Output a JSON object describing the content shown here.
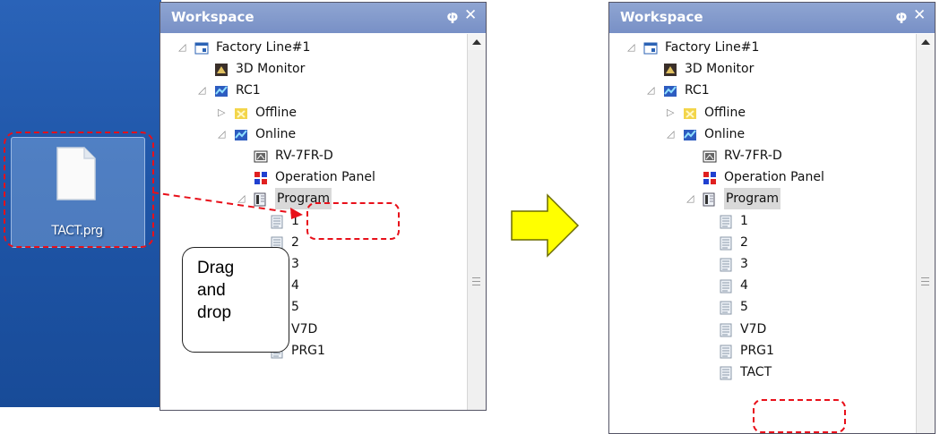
{
  "desktop": {
    "file": {
      "name": "TACT.prg"
    }
  },
  "callout": {
    "lines": [
      "Drag",
      "and",
      "drop"
    ]
  },
  "workspace": {
    "title": "Workspace",
    "pin_glyph": "p",
    "close_glyph": "✕",
    "tree": [
      {
        "label": "Factory Line#1",
        "level": 0,
        "expander": "◿",
        "icon": "project-icon"
      },
      {
        "label": "3D Monitor",
        "level": 1,
        "expander": "",
        "icon": "3d-monitor-icon"
      },
      {
        "label": "RC1",
        "level": 1,
        "expander": "◿",
        "icon": "robot-controller-icon"
      },
      {
        "label": "Offline",
        "level": 2,
        "expander": "▷",
        "icon": "offline-icon"
      },
      {
        "label": "Online",
        "level": 2,
        "expander": "◿",
        "icon": "online-icon"
      },
      {
        "label": "RV-7FR-D",
        "level": 3,
        "expander": "",
        "icon": "robot-icon"
      },
      {
        "label": "Operation Panel",
        "level": 3,
        "expander": "",
        "icon": "operation-panel-icon"
      },
      {
        "label": "Program",
        "level": 3,
        "expander": "◿",
        "icon": "program-folder-icon"
      },
      {
        "label": "1",
        "level": 4,
        "expander": "",
        "icon": "program-file-icon"
      },
      {
        "label": "2",
        "level": 4,
        "expander": "",
        "icon": "program-file-icon"
      },
      {
        "label": "3",
        "level": 4,
        "expander": "",
        "icon": "program-file-icon"
      },
      {
        "label": "4",
        "level": 4,
        "expander": "",
        "icon": "program-file-icon"
      },
      {
        "label": "5",
        "level": 4,
        "expander": "",
        "icon": "program-file-icon"
      },
      {
        "label": "V7D",
        "level": 4,
        "expander": "",
        "icon": "program-file-icon"
      },
      {
        "label": "PRG1",
        "level": 4,
        "expander": "",
        "icon": "program-file-icon"
      }
    ],
    "added_item": {
      "label": "TACT",
      "icon": "program-file-icon"
    }
  },
  "colors": {
    "highlight": "#e8101a",
    "arrow_fill": "#ffff00",
    "title_bar": "#7d93c9"
  }
}
